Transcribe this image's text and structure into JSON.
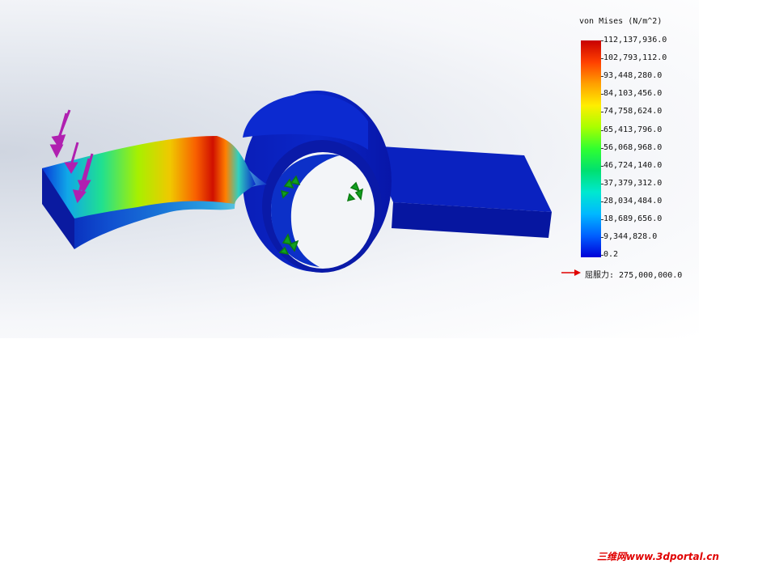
{
  "legend": {
    "title": "von Mises (N/m^2)",
    "ticks": [
      "112,137,936.0",
      "102,793,112.0",
      "93,448,280.0",
      "84,103,456.0",
      "74,758,624.0",
      "65,413,796.0",
      "56,068,968.0",
      "46,724,140.0",
      "37,379,312.0",
      "28,034,484.0",
      "18,689,656.0",
      "9,344,828.0",
      "0.2"
    ],
    "yield_label": "屈服力: 275,000,000.0",
    "colors": {
      "max": "#c80000",
      "min": "#0000d8",
      "yield_arrow": "#e00000"
    }
  },
  "watermark": "三维网www.3dportal.cn"
}
